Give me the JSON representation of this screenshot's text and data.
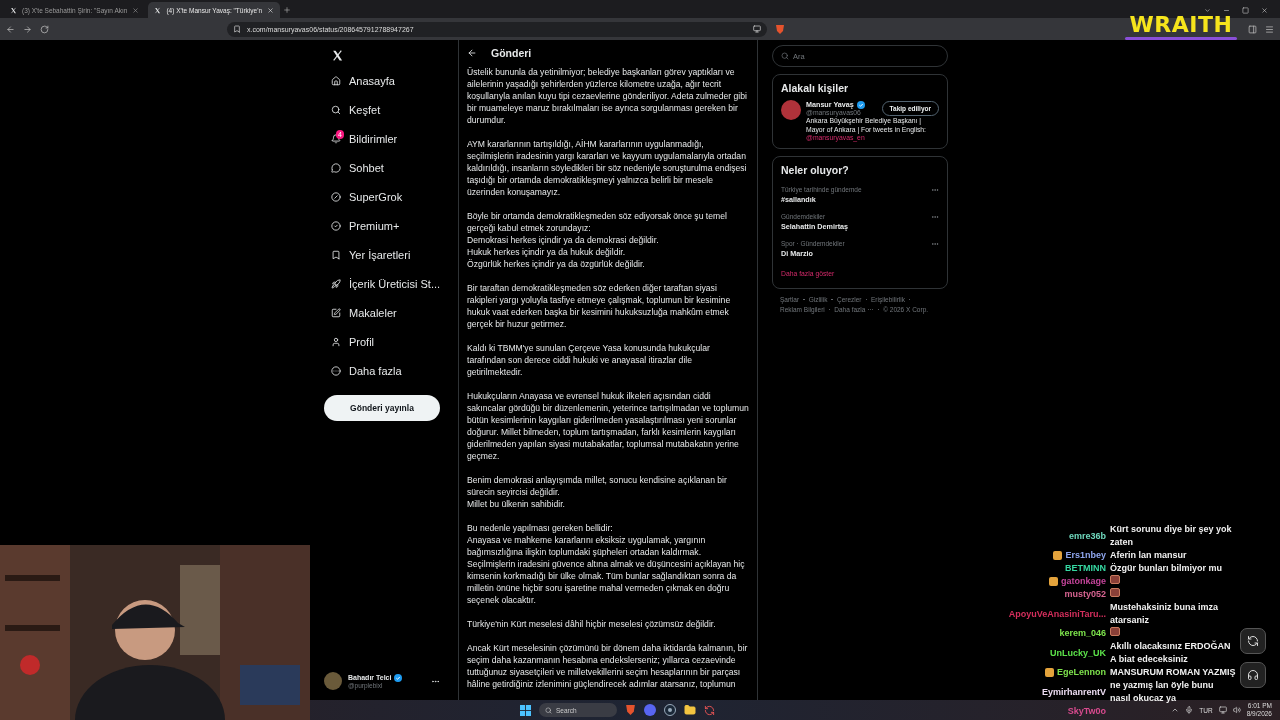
{
  "browser": {
    "tabs": [
      {
        "title": "(3) X'te Sebahattin Şirin: \"Sayın Akın",
        "selected": false
      },
      {
        "title": "(4) X'te Mansur Yavaş: \"Türkiye'n",
        "selected": true
      }
    ],
    "url": "x.com/mansuryavas06/status/2086457912788947267"
  },
  "sidebar": {
    "items": [
      {
        "label": "Anasayfa"
      },
      {
        "label": "Keşfet"
      },
      {
        "label": "Bildirimler",
        "badge": "4"
      },
      {
        "label": "Sohbet"
      },
      {
        "label": "SuperGrok"
      },
      {
        "label": "Premium+"
      },
      {
        "label": "Yer İşaretleri"
      },
      {
        "label": "İçerik Üreticisi St..."
      },
      {
        "label": "Makaleler"
      },
      {
        "label": "Profil"
      },
      {
        "label": "Daha fazla"
      }
    ],
    "post_button": "Gönderi yayınla",
    "account": {
      "name": "Bahadır Telci",
      "handle": "@purplebixl"
    }
  },
  "post": {
    "title": "Gönderi",
    "paragraphs": [
      [
        "Üstelik bununla da yetinilmiyor; belediye başkanları görev yaptıkları ve ailelerinin yaşadığı şehirlerden yüzlerce kilometre uzağa, ağır tecrit koşullarıyla anılan kuyu tipi cezaevlerine gönderiliyor. Adeta zulmeder gibi bir muameleye maruz bırakılmaları ise ayrıca sorgulanması gereken bir durumdur."
      ],
      [
        "AYM kararlarının tartışıldığı, AİHM kararlarının uygulanmadığı, seçilmişlerin iradesinin yargı kararları ve kayyum uygulamalarıyla ortadan kaldırıldığı, insanların söyledikleri bir söz nedeniyle soruşturulma endişesi taşıdığı bir ortamda demokratikleşmeyi yalnızca belirli bir mesele üzerinden konuşamayız."
      ],
      [
        "Böyle bir ortamda demokratikleşmeden söz ediyorsak önce şu temel gerçeği kabul etmek zorundayız:",
        "Demokrasi herkes içindir ya da demokrasi değildir.",
        "Hukuk herkes içindir ya da hukuk değildir.",
        "Özgürlük herkes içindir ya da özgürlük değildir."
      ],
      [
        "Bir taraftan demokratikleşmeden söz ederken diğer taraftan siyasi rakipleri yargı yoluyla tasfiye etmeye çalışmak, toplumun bir kesimine hukuk vaat ederken başka bir kesimini hukuksuzluğa mahkûm etmek gerçek bir huzur getirmez."
      ],
      [
        "Kaldı ki TBMM'ye sunulan Çerçeve Yasa konusunda hukukçular tarafından son derece ciddi hukuki ve anayasal itirazlar dile getirilmektedir."
      ],
      [
        "Hukukçuların Anayasa ve evrensel hukuk ilkeleri açısından ciddi sakıncalar gördüğü bir düzenlemenin, yeterince tartışılmadan ve toplumun bütün kesimlerinin kaygıları giderilmeden yasalaştırılması yeni sorunlar doğurur. Millet bilmeden, toplum tartışmadan, farklı kesimlerin kaygıları giderilmeden yapılan siyasi mutabakatlar, toplumsal mutabakatın yerine geçmez."
      ],
      [
        "Benim demokrasi anlayışımda millet, sonucu kendisine açıklanan bir sürecin seyircisi değildir.",
        "Millet bu ülkenin sahibidir."
      ],
      [
        "Bu nedenle yapılması gereken bellidir:",
        "Anayasa ve mahkeme kararlarını eksiksiz uygulamak, yargının bağımsızlığına ilişkin toplumdaki şüpheleri ortadan kaldırmak. Seçilmişlerin iradesini güvence altına almak ve düşüncesini açıklayan hiç kimsenin korkmadığı bir ülke olmak. Tüm bunlar sağlandıktan sonra da milletin önüne hiçbir soru işaretine mahal vermeden çıkmak en doğru seçenek olacaktır."
      ],
      [
        "Türkiye'nin Kürt meselesi dâhil hiçbir meselesi çözümsüz değildir."
      ],
      [
        "Ancak Kürt meselesinin çözümünü bir dönem daha iktidarda kalmanın, bir seçim daha kazanmanın hesabına endekslerseniz; yıllarca cezaevinde tuttuğunuz siyasetçileri ve milletvekillerini seçim hesaplarının bir parçası hâline getirdiğiniz izlenimini güçlendirecek adımlar atarsanız, toplumun"
      ]
    ]
  },
  "right": {
    "search": {
      "placeholder": "Ara"
    },
    "people": {
      "title": "Alakalı kişiler",
      "person": {
        "name": "Mansur Yavaş",
        "handle": "@mansuryavas06",
        "follow": "Takip ediliyor",
        "bio": "Ankara Büyükşehir Belediye Başkanı | Mayor of Ankara | For tweets in English:",
        "link": "@mansuryavas_en"
      }
    },
    "trends": {
      "title": "Neler oluyor?",
      "items": [
        {
          "context": "Türkiye tarihinde gündemde",
          "title": "#sallandık"
        },
        {
          "context": "Gündemdekiler",
          "title": "Selahattin Demirtaş"
        },
        {
          "context": "Spor · Gündemdekiler",
          "title": "Di Marzio"
        }
      ],
      "more": "Daha fazla göster"
    },
    "footer": [
      "Şartlar",
      "Gizlilik",
      "Çerezler",
      "Erişilebilirlik",
      "Reklam Bilgileri",
      "Daha fazla ···",
      "© 2026 X Corp."
    ]
  },
  "overlay": {
    "logo": "WRAITH"
  },
  "chat": [
    {
      "user": "emre36b",
      "color": "#6fd8bd",
      "badge": false,
      "kind": "text",
      "text": "Kürt sorunu diye bir şey yok zaten"
    },
    {
      "user": "Ers1nbey",
      "color": "#8fa6ee",
      "badge": true,
      "kind": "text",
      "text": "Aferin lan mansur"
    },
    {
      "user": "BETMINN",
      "color": "#36d8a2",
      "badge": false,
      "kind": "text",
      "text": "Özgür bunları bilmiyor mu"
    },
    {
      "user": "gatonkage",
      "color": "#c4449a",
      "badge": true,
      "kind": "emote"
    },
    {
      "user": "musty052",
      "color": "#d66390",
      "badge": false,
      "kind": "emote"
    },
    {
      "user": "ApoyuVeAnasiniTaru...",
      "color": "#d42e5c",
      "badge": false,
      "kind": "text",
      "text": "Mustehaksiniz buna imza atarsaniz"
    },
    {
      "user": "kerem_046",
      "color": "#7de34c",
      "badge": false,
      "kind": "emote"
    },
    {
      "user": "UnLucky_UK",
      "color": "#5ce24a",
      "badge": false,
      "kind": "text",
      "text": "Akıllı olacaksınız ERDOĞAN A biat edeceksiniz"
    },
    {
      "user": "EgeLennon",
      "color": "#7ee24c",
      "badge": true,
      "kind": "text",
      "text": "MANSURUM ROMAN YAZMIŞ"
    },
    {
      "user": "EymirhanrentV",
      "color": "#ecdcf2",
      "badge": false,
      "kind": "text",
      "text": "ne yazmış lan öyle bunu nasıl okucaz ya"
    },
    {
      "user": "SkyTw0o",
      "color": "#d84a8e",
      "badge": false,
      "kind": "name"
    }
  ],
  "taskbar": {
    "search": {
      "placeholder": "Search"
    },
    "language": "TUR",
    "time": "6:01 PM",
    "date": "8/9/2026"
  }
}
